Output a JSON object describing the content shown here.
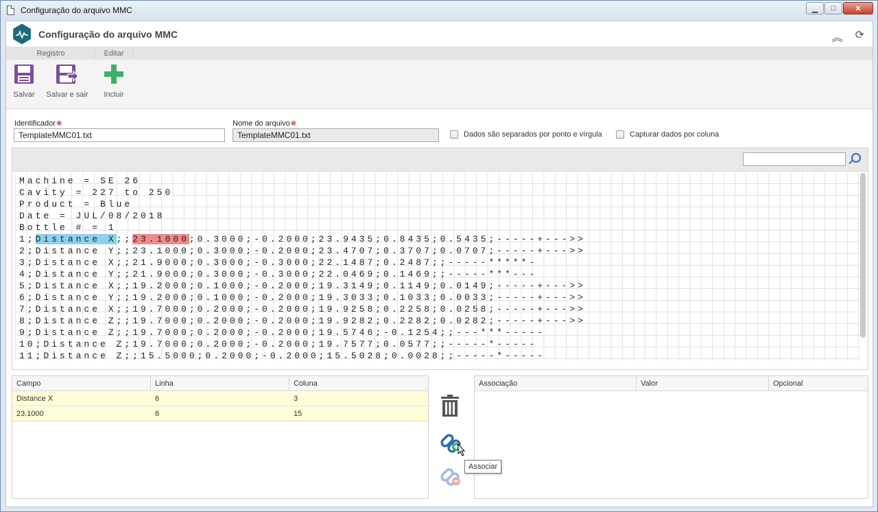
{
  "window": {
    "title": "Configuração do arquivo MMC",
    "minimize_icon": "minimize-icon",
    "maximize_icon": "maximize-icon",
    "close_icon": "close-icon"
  },
  "header": {
    "title": "Configuração do arquivo MMC",
    "collapse_icon": "double-chevron-up-icon",
    "refresh_icon": "refresh-icon"
  },
  "ribbon": {
    "groups": [
      {
        "label": "Registro"
      },
      {
        "label": "Editar"
      }
    ],
    "buttons": {
      "save": "Salvar",
      "save_exit": "Salvar e sair",
      "add": "Incluir"
    }
  },
  "form": {
    "identifier_label": "Identificador",
    "identifier_value": "TemplateMMC01.txt",
    "filename_label": "Nome do arquivo",
    "filename_value": "TemplateMMC01.txt",
    "semicolon_label": "Dados são separados por ponto e vírgula",
    "column_label": "Capturar dados por coluna",
    "required_mark": "❋"
  },
  "file_lines": [
    "Machine = SE 26",
    "Cavity = 227 to 250",
    "Product = Blue",
    "Date = JUL/08/2018",
    "Bottle # = 1",
    "1;Distance X;;23.1000;0.3000;-0.2000;23.9435;0.8435;0.5435;-----+--->>",
    "2;Distance Y;;23.1000;0.3000;-0.2000;23.4707;0.3707;0.0707;-----+--->>",
    "3;Distance X;;21.9000;0.3000;-0.3000;22.1487;0.2487;;-----*****-",
    "4;Distance Y;;21.9000;0.3000;-0.3000;22.0469;0.1469;;-----***---",
    "5;Distance X;;19.2000;0.1000;-0.2000;19.3149;0.1149;0.0149;-----+--->>",
    "6;Distance Y;;19.2000;0.1000;-0.2000;19.3033;0.1033;0.0033;-----+--->>",
    "7;Distance X;;19.7000;0.2000;-0.2000;19.9258;0.2258;0.0258;-----+--->>",
    "8;Distance Z;;19.7000;0.2000;-0.2000;19.9282;0.2282;0.0282;-----+--->>",
    "9;Distance Z;;19.7000;0.2000;-0.2000;19.5746;-0.1254;;---***-----",
    "10;Distance Z;19.7000;0.2000;-0.2000;19.7577;0.0577;;-----*-----",
    "11;Distance Z;;15.5000;0.2000;-0.2000;15.5028;0.0028;;-----*-----"
  ],
  "fields_table": {
    "columns": [
      "Campo",
      "Linha",
      "Coluna"
    ],
    "rows": [
      {
        "campo": "Distance X",
        "linha": "6",
        "coluna": "3"
      },
      {
        "campo": "23.1000",
        "linha": "6",
        "coluna": "15"
      }
    ]
  },
  "association_table": {
    "columns": [
      "Associação",
      "Valor",
      "Opcional"
    ]
  },
  "actions": {
    "delete_icon": "trash-icon",
    "associate_icon": "link-add-icon",
    "disassociate_icon": "link-remove-icon",
    "tooltip": "Associar"
  }
}
